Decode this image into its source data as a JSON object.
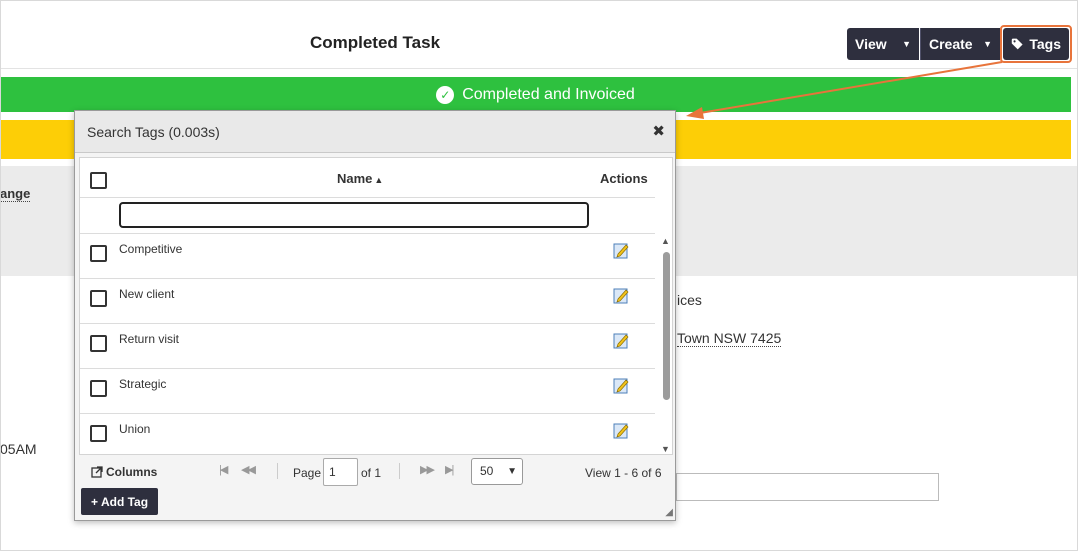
{
  "header": {
    "title": "Completed Task",
    "view_label": "View",
    "create_label": "Create",
    "tags_label": "Tags"
  },
  "status": {
    "green_text": "Completed and Invoiced",
    "green_color": "#2ec13f",
    "yellow_color": "#fdce06"
  },
  "background": {
    "change_text": "ange",
    "ices_text": "ices",
    "town_text": "Town NSW 7425",
    "time_text": "05AM"
  },
  "modal": {
    "title": "Search Tags (0.003s)",
    "close_symbol": "✖",
    "columns": {
      "name": "Name",
      "actions": "Actions"
    },
    "filter_value": "",
    "rows": [
      {
        "label": "Competitive"
      },
      {
        "label": "New client"
      },
      {
        "label": "Return visit"
      },
      {
        "label": "Strategic"
      },
      {
        "label": "Union"
      }
    ],
    "pager": {
      "columns_label": "Columns",
      "page_label": "Page",
      "page_value": "1",
      "of_label": "of 1",
      "rows_per_page": "50",
      "view_text": "View 1 - 6 of 6"
    },
    "add_tag_label": "Add Tag"
  },
  "accent_color": "#e8743b",
  "icons": [
    "tag-icon",
    "check-circle-icon",
    "close-icon",
    "sort-icon",
    "edit-icon",
    "columns-icon",
    "plus-icon"
  ]
}
